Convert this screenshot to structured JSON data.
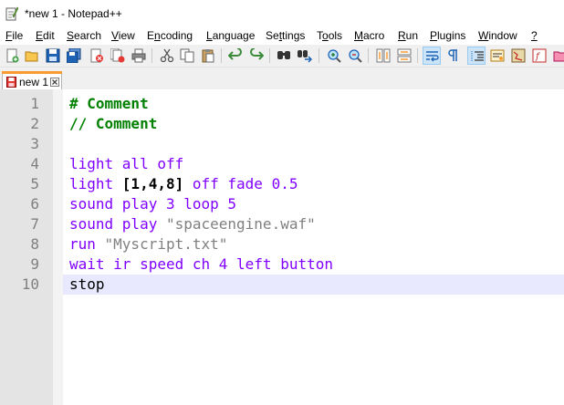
{
  "window": {
    "title": "*new 1 - Notepad++"
  },
  "menu": [
    {
      "pre": "",
      "u": "F",
      "post": "ile"
    },
    {
      "pre": "",
      "u": "E",
      "post": "dit"
    },
    {
      "pre": "",
      "u": "S",
      "post": "earch"
    },
    {
      "pre": "",
      "u": "V",
      "post": "iew"
    },
    {
      "pre": "E",
      "u": "n",
      "post": "coding"
    },
    {
      "pre": "",
      "u": "L",
      "post": "anguage"
    },
    {
      "pre": "Se",
      "u": "t",
      "post": "tings"
    },
    {
      "pre": "T",
      "u": "o",
      "post": "ols"
    },
    {
      "pre": "",
      "u": "M",
      "post": "acro"
    },
    {
      "pre": "",
      "u": "R",
      "post": "un"
    },
    {
      "pre": "",
      "u": "P",
      "post": "lugins"
    },
    {
      "pre": "",
      "u": "W",
      "post": "indow"
    },
    {
      "pre": "",
      "u": "?",
      "post": ""
    }
  ],
  "toolbar": {
    "icons": [
      "new-file-icon",
      "open-file-icon",
      "save-icon",
      "save-all-icon",
      "close-icon",
      "close-all-icon",
      "print-icon",
      "cut-icon",
      "copy-icon",
      "paste-icon",
      "undo-icon",
      "redo-icon",
      "find-icon",
      "replace-icon",
      "zoom-in-icon",
      "zoom-out-icon",
      "sync-vertical-icon",
      "sync-horizontal-icon",
      "word-wrap-icon",
      "show-all-chars-icon",
      "indent-guide-icon",
      "user-defined-language-icon",
      "document-map-icon",
      "function-list-icon",
      "folder-as-workspace-icon"
    ],
    "active": [
      "word-wrap-icon",
      "indent-guide-icon"
    ]
  },
  "tab": {
    "label": "new 1"
  },
  "editor": {
    "line_numbers": [
      "1",
      "2",
      "3",
      "4",
      "5",
      "6",
      "7",
      "8",
      "9",
      "10"
    ],
    "lines": [
      [
        {
          "t": "# Comment",
          "c": "comment"
        }
      ],
      [
        {
          "t": "// Comment",
          "c": "comment"
        }
      ],
      [],
      [
        {
          "t": "light all off",
          "c": "keyword"
        }
      ],
      [
        {
          "t": "light ",
          "c": "keyword"
        },
        {
          "t": "[1,4,8]",
          "c": "bracket"
        },
        {
          "t": " off fade 0.5",
          "c": "keyword"
        }
      ],
      [
        {
          "t": "sound play 3 loop 5",
          "c": "keyword"
        }
      ],
      [
        {
          "t": "sound play ",
          "c": "keyword"
        },
        {
          "t": "\"spaceengine.waf\"",
          "c": "string"
        }
      ],
      [
        {
          "t": "run ",
          "c": "keyword"
        },
        {
          "t": "\"Myscript.txt\"",
          "c": "string"
        }
      ],
      [
        {
          "t": "wait ir speed ch 4 left button",
          "c": "keyword"
        }
      ],
      [
        {
          "t": "stop",
          "c": "plain"
        }
      ]
    ],
    "caret_line": 10
  }
}
